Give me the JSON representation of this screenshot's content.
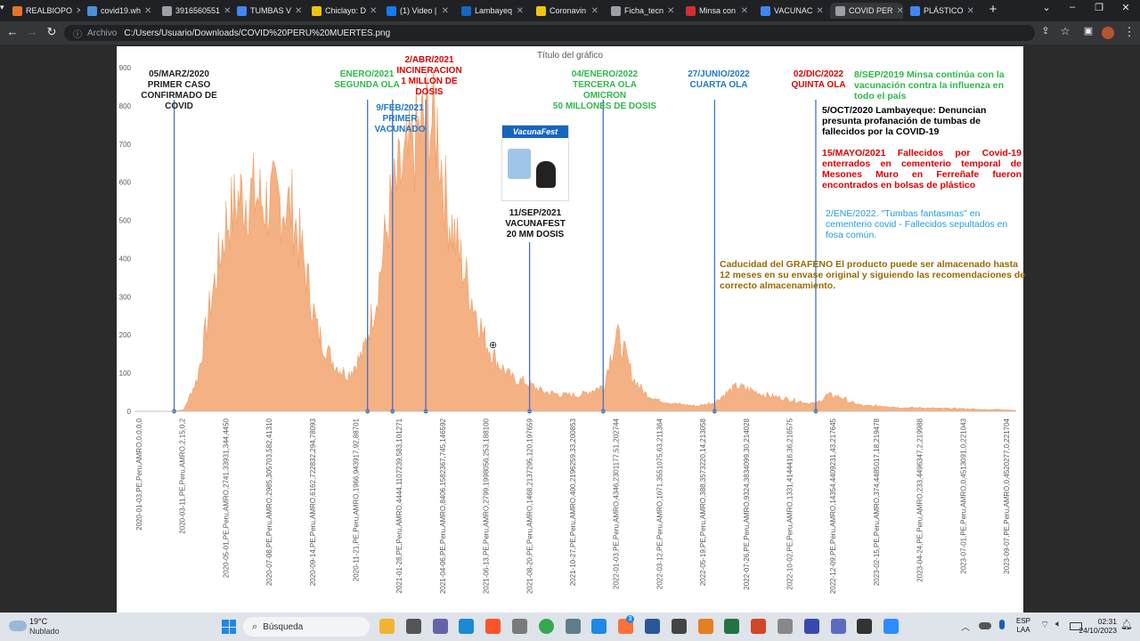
{
  "tabs": [
    {
      "label": "REALBIOPO",
      "color": "#e6732b"
    },
    {
      "label": "covid19.wh",
      "color": "#4a90d9"
    },
    {
      "label": "3916560551",
      "color": "#9aa0a6"
    },
    {
      "label": "TUMBAS V",
      "color": "#4285f4"
    },
    {
      "label": "Chiclayo: D",
      "color": "#f1c40f"
    },
    {
      "label": "(1) Video |",
      "color": "#1877f2"
    },
    {
      "label": "Lambayeq",
      "color": "#1565c0"
    },
    {
      "label": "Coronavin",
      "color": "#f1c40f"
    },
    {
      "label": "Ficha_tecn",
      "color": "#9aa0a6"
    },
    {
      "label": "Minsa con",
      "color": "#d32f2f"
    },
    {
      "label": "VACUNAC",
      "color": "#4285f4"
    },
    {
      "label": "COVID PER",
      "color": "#9aa0a6"
    },
    {
      "label": "PLÁSTICO",
      "color": "#4285f4"
    }
  ],
  "active_tab_index": 11,
  "address": {
    "label": "Archivo",
    "url": "C:/Users/Usuario/Downloads/COVID%20PERU%20MUERTES.png"
  },
  "chart_data": {
    "type": "area",
    "title": "Título del gráfico",
    "ylim": [
      0,
      900
    ],
    "yticks": [
      0,
      100,
      200,
      300,
      400,
      500,
      600,
      700,
      800,
      900
    ],
    "color": "#f4b183",
    "x_start": "2020-01-03",
    "x_end": "2023-10-11",
    "series": [
      {
        "x": [
          "2020-03-05",
          "2020-03-20",
          "2020-04-10",
          "2020-05-01",
          "2020-05-25",
          "2020-06-15",
          "2020-07-05",
          "2020-07-25",
          "2020-08-15",
          "2020-09-05",
          "2020-09-25",
          "2020-10-15",
          "2020-11-10",
          "2020-12-01",
          "2020-12-25",
          "2021-01-15",
          "2021-02-05",
          "2021-02-20",
          "2021-03-05",
          "2021-03-20",
          "2021-04-05",
          "2021-04-20",
          "2021-05-05",
          "2021-05-25",
          "2021-06-15",
          "2021-07-05",
          "2021-07-25",
          "2021-08-15",
          "2021-09-05",
          "2021-10-01",
          "2021-11-01",
          "2021-12-01",
          "2021-12-20",
          "2022-01-05",
          "2022-01-15",
          "2022-01-25",
          "2022-02-05",
          "2022-02-20",
          "2022-03-10",
          "2022-04-01",
          "2022-05-01",
          "2022-06-01",
          "2022-06-27",
          "2022-07-15",
          "2022-08-01",
          "2022-08-20",
          "2022-09-15",
          "2022-10-15",
          "2022-11-15",
          "2022-12-02",
          "2022-12-20",
          "2023-01-10",
          "2023-01-25",
          "2023-02-15",
          "2023-03-15",
          "2023-04-15",
          "2023-05-15",
          "2023-06-15",
          "2023-07-15",
          "2023-08-15",
          "2023-09-15",
          "2023-10-11"
        ],
        "y": [
          0,
          5,
          90,
          300,
          520,
          590,
          600,
          575,
          580,
          560,
          400,
          220,
          130,
          100,
          160,
          320,
          560,
          640,
          690,
          760,
          810,
          780,
          560,
          430,
          300,
          190,
          130,
          90,
          80,
          55,
          45,
          45,
          60,
          70,
          150,
          210,
          170,
          90,
          50,
          30,
          20,
          15,
          25,
          50,
          70,
          60,
          45,
          35,
          25,
          20,
          45,
          40,
          25,
          15,
          15,
          10,
          10,
          8,
          8,
          5,
          5,
          3
        ]
      }
    ],
    "xtick_labels": [
      "2020-01-03,PE,Peru,AMRO,0,0,0,0",
      "2020-03-11,PE,Peru,AMRO,2,15,0,2",
      "2020-05-01,PE,Peru,AMRO,2741,33931,344,4450",
      "2020-07-08,PE,Peru,AMRO,2985,305703,582,41310",
      "2020-09-14,PE,Peru,AMRO,6162,722832,294,78093",
      "2020-11-21,PE,Peru,AMRO,1966,943917,92,88701",
      "2021-01-28,PE,Peru,AMRO,4444,1107239,583,101271",
      "2021-04-06,PE,Peru,AMRO,8406,1582367,745,146592",
      "2021-06-13,PE,Peru,AMRO,2799,1998056,253,188100",
      "2021-08-20,PE,Peru,AMRO,1468,2137295,120,197659",
      "2021-10-27,PE,Peru,AMRO,400,2196259,33,200853",
      "2022-01-03,PE,Peru,AMRO,4346,2301177,51,202744",
      "2022-03-12,PE,Peru,AMRO,1071,3551075,63,211364",
      "2022-05-19,PE,Peru,AMRO,388,3573220,14,213058",
      "2022-07-26,PE,Peru,AMRO,9324,3834099,30,214028",
      "2022-10-02,PE,Peru,AMRO,1331,4144416,36,216575",
      "2022-12-09,PE,Peru,AMRO,14354,4409231,43,217645",
      "2023-02-15,PE,Peru,AMRO,374,4485017,18,219478",
      "2023-04-24,PE,Peru,AMRO,233,4496347,2,219988",
      "2023-07-01,PE,Peru,AMRO,0,4513091,0,221043",
      "2023-09-07,PE,Peru,AMRO,0,4520277,0,221704"
    ]
  },
  "annotations": {
    "first_case": "05/MARZ/2020\nPRIMER CASO\nCONFIRMADO DE\nCOVID",
    "second_wave": "ENERO/2021\nSEGUNDA OLA",
    "incineration": "2/ABR/2021\nINCINERACION\n1 MILLON DE\nDOSIS",
    "first_vaccinated": "9/FEB/2021\nPRIMER\nVACUNADO",
    "third_wave": "04/ENERO/2022\nTERCERA OLA\nOMICRON\n50 MILLONES DE DOSIS",
    "vacunafest": "11/SEP/2021\nVACUNAFEST\n20 MM DOSIS",
    "vacunafest_logo": "VacunaFest",
    "fourth_wave": "27/JUNIO/2022\nCUARTA OLA",
    "fifth_wave": "02/DIC/2022\nQUINTA OLA",
    "note_influenza": "8/SEP/2019 Minsa continúa con la vacunación contra la influenza en todo el país",
    "note_lambayeque": "5/OCT/2020 Lambayeque: Denuncian presunta profanación de tumbas de fallecidos por la COVID-19",
    "note_mesones": "15/MAYO/2021 Fallecidos por Covid-19 enterrados en cementerio temporal de Mesones Muro en Ferreñafe fueron encontrados en bolsas de plástico",
    "note_tumbas": "2/ENE/2022. \"Tumbas fantasmas\" en cementerio covid - Fallecidos sepultados en fosa común.",
    "note_grafeno": "Caducidad del GRAFENO El producto puede ser almacenado hasta 12 meses en su envase original y siguiendo las recomendaciones de correcto almacenamiento."
  },
  "taskbar": {
    "weather_temp": "19°C",
    "weather_desc": "Nublado",
    "search_label": "Búsqueda",
    "lang_1": "ESP",
    "lang_2": "LAA",
    "time": "02:31",
    "date": "24/10/2023",
    "badge": "3"
  }
}
